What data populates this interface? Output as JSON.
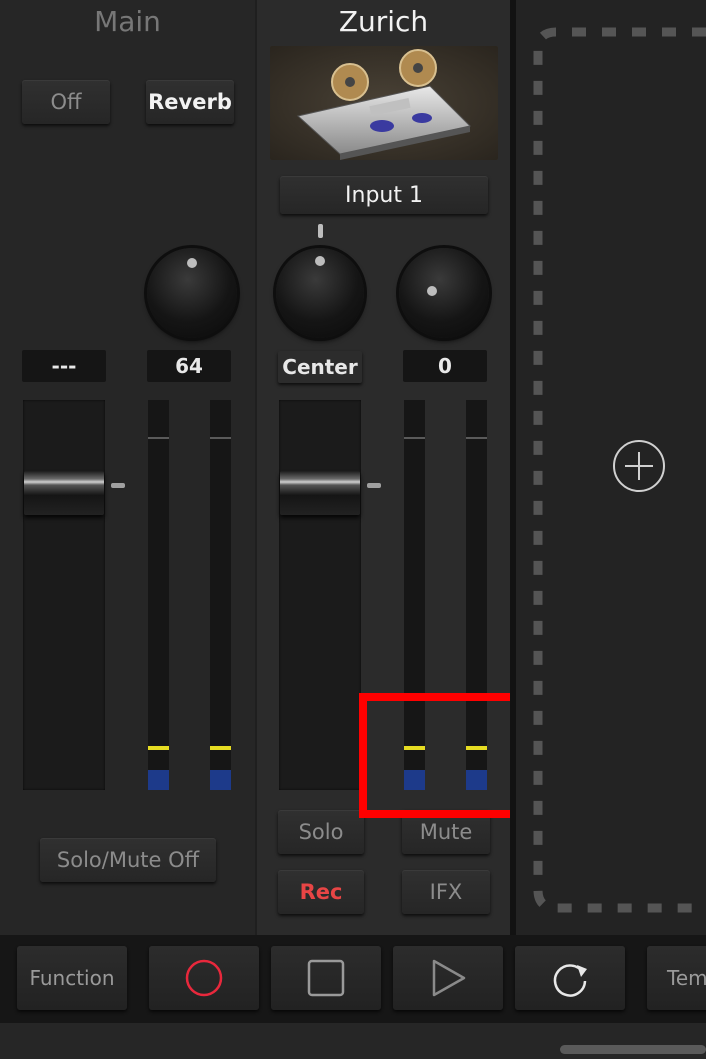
{
  "channels": {
    "main": {
      "title": "Main",
      "off_label": "Off",
      "reverb_label": "Reverb",
      "value_left": "---",
      "value_right": "64",
      "solo_mute_off_label": "Solo/Mute Off"
    },
    "zurich": {
      "title": "Zurich",
      "input_label": "Input 1",
      "pan_label": "Center",
      "send_value": "0",
      "solo_label": "Solo",
      "mute_label": "Mute",
      "rec_label": "Rec",
      "ifx_label": "IFX"
    }
  },
  "toolbar": {
    "function_label": "Function",
    "tempo_label": "Tem"
  },
  "icons": {
    "record": "record-icon",
    "stop": "stop-icon",
    "play": "play-icon",
    "loop": "loop-icon",
    "add": "plus-circle-icon"
  },
  "colors": {
    "record_red": "#e8283c",
    "meter_peak": "#e6dc22",
    "meter_fill": "#1d3a8a",
    "highlight": "#ff0000",
    "rec_text": "#e84545"
  }
}
